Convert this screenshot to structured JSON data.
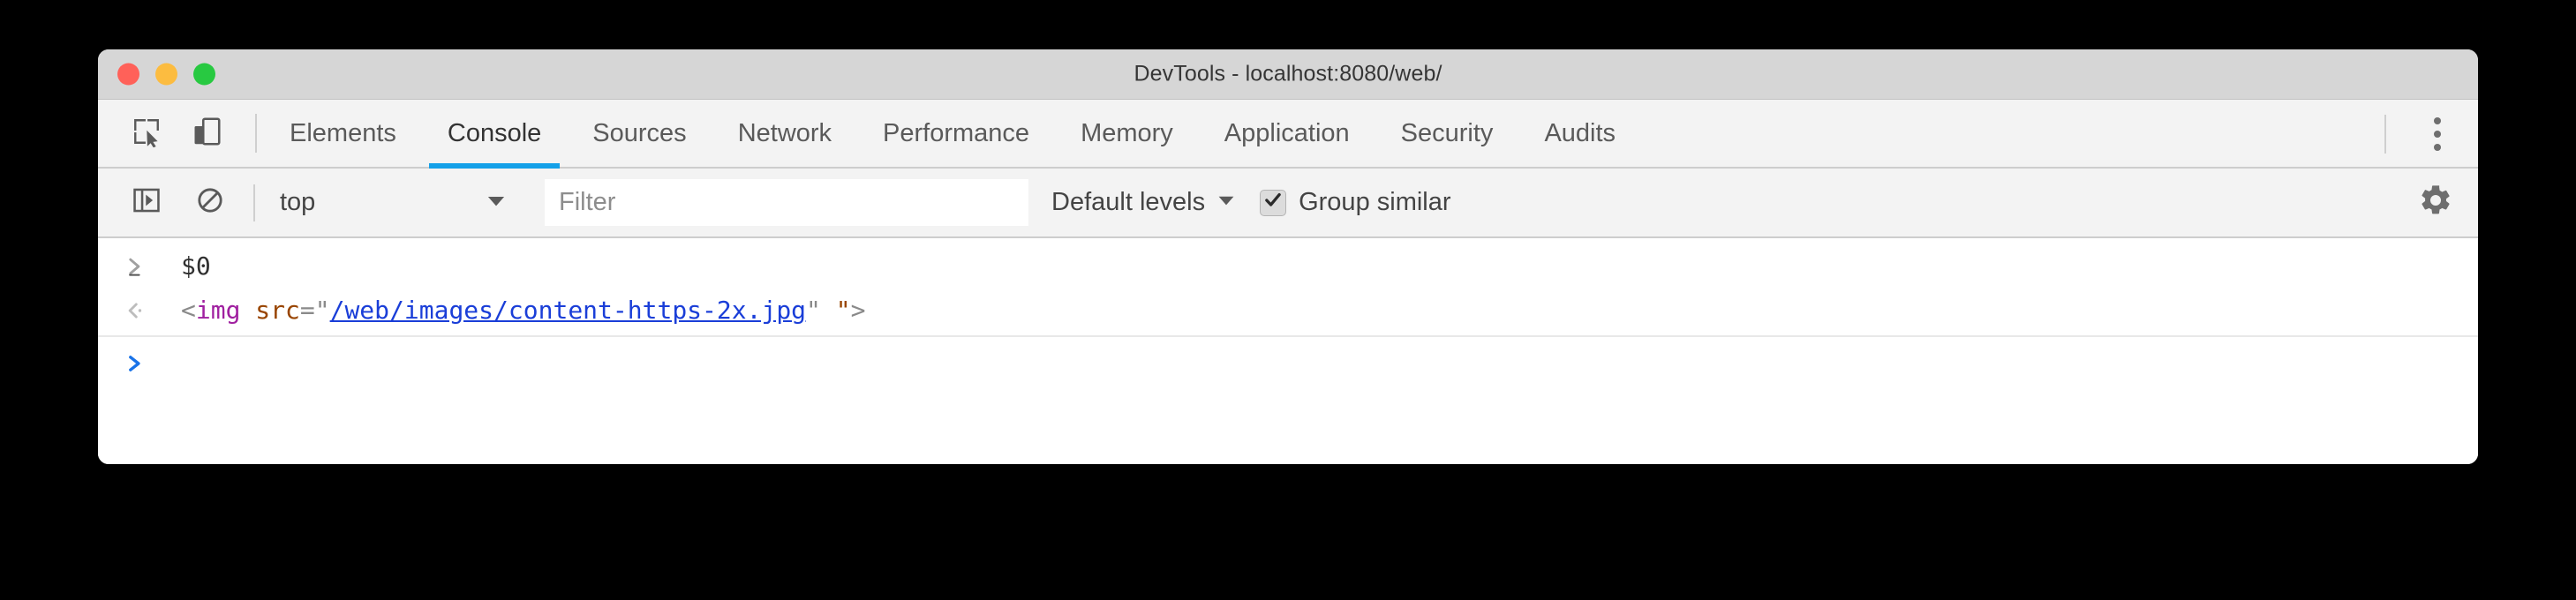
{
  "window": {
    "title": "DevTools - localhost:8080/web/",
    "traffic_lights": [
      {
        "name": "close",
        "color": "#ff6159"
      },
      {
        "name": "minimize",
        "color": "#fcbc40"
      },
      {
        "name": "maximize",
        "color": "#28c941"
      }
    ]
  },
  "tabbar": {
    "inspect_icon": "inspect-element-icon",
    "device_icon": "device-toolbar-icon",
    "overflow_icon": "more-vertical-icon",
    "tabs": [
      {
        "label": "Elements",
        "active": false
      },
      {
        "label": "Console",
        "active": true
      },
      {
        "label": "Sources",
        "active": false
      },
      {
        "label": "Network",
        "active": false
      },
      {
        "label": "Performance",
        "active": false
      },
      {
        "label": "Memory",
        "active": false
      },
      {
        "label": "Application",
        "active": false
      },
      {
        "label": "Security",
        "active": false
      },
      {
        "label": "Audits",
        "active": false
      }
    ],
    "active_tab_underline_color": "#14a0e8"
  },
  "console_toolbar": {
    "sidebar_toggle_icon": "console-sidebar-toggle-icon",
    "clear_console_icon": "clear-console-icon",
    "context_selector": {
      "value": "top",
      "arrow_icon": "chevron-down-icon"
    },
    "filter": {
      "value": "",
      "placeholder": "Filter"
    },
    "levels_selector": {
      "value": "Default levels",
      "arrow_icon": "chevron-down-icon"
    },
    "group_similar": {
      "label": "Group similar",
      "checked": true,
      "check_icon": "checkmark-icon"
    },
    "settings_icon": "gear-icon"
  },
  "console": {
    "rows": [
      {
        "type": "input",
        "gutter_icon": "prompt-chevron-right-gray",
        "text": "$0"
      },
      {
        "type": "output",
        "gutter_icon": "result-chevron-left-gray",
        "tokens": [
          {
            "text": "<",
            "kind": "punct"
          },
          {
            "text": "img",
            "kind": "tag"
          },
          {
            "text": " ",
            "kind": "plain"
          },
          {
            "text": "src",
            "kind": "attr"
          },
          {
            "text": "=\"",
            "kind": "punct"
          },
          {
            "text": "/web/images/content-https-2x.jpg",
            "kind": "link"
          },
          {
            "text": "\"",
            "kind": "punct"
          },
          {
            "text": " ",
            "kind": "plain"
          },
          {
            "text": "\"",
            "kind": "attr"
          },
          {
            "text": ">",
            "kind": "punct"
          }
        ],
        "plain_text": "<img src=\"/web/images/content-https-2x.jpg\" \">"
      },
      {
        "type": "prompt",
        "gutter_icon": "prompt-chevron-right-blue",
        "text": ""
      }
    ]
  }
}
